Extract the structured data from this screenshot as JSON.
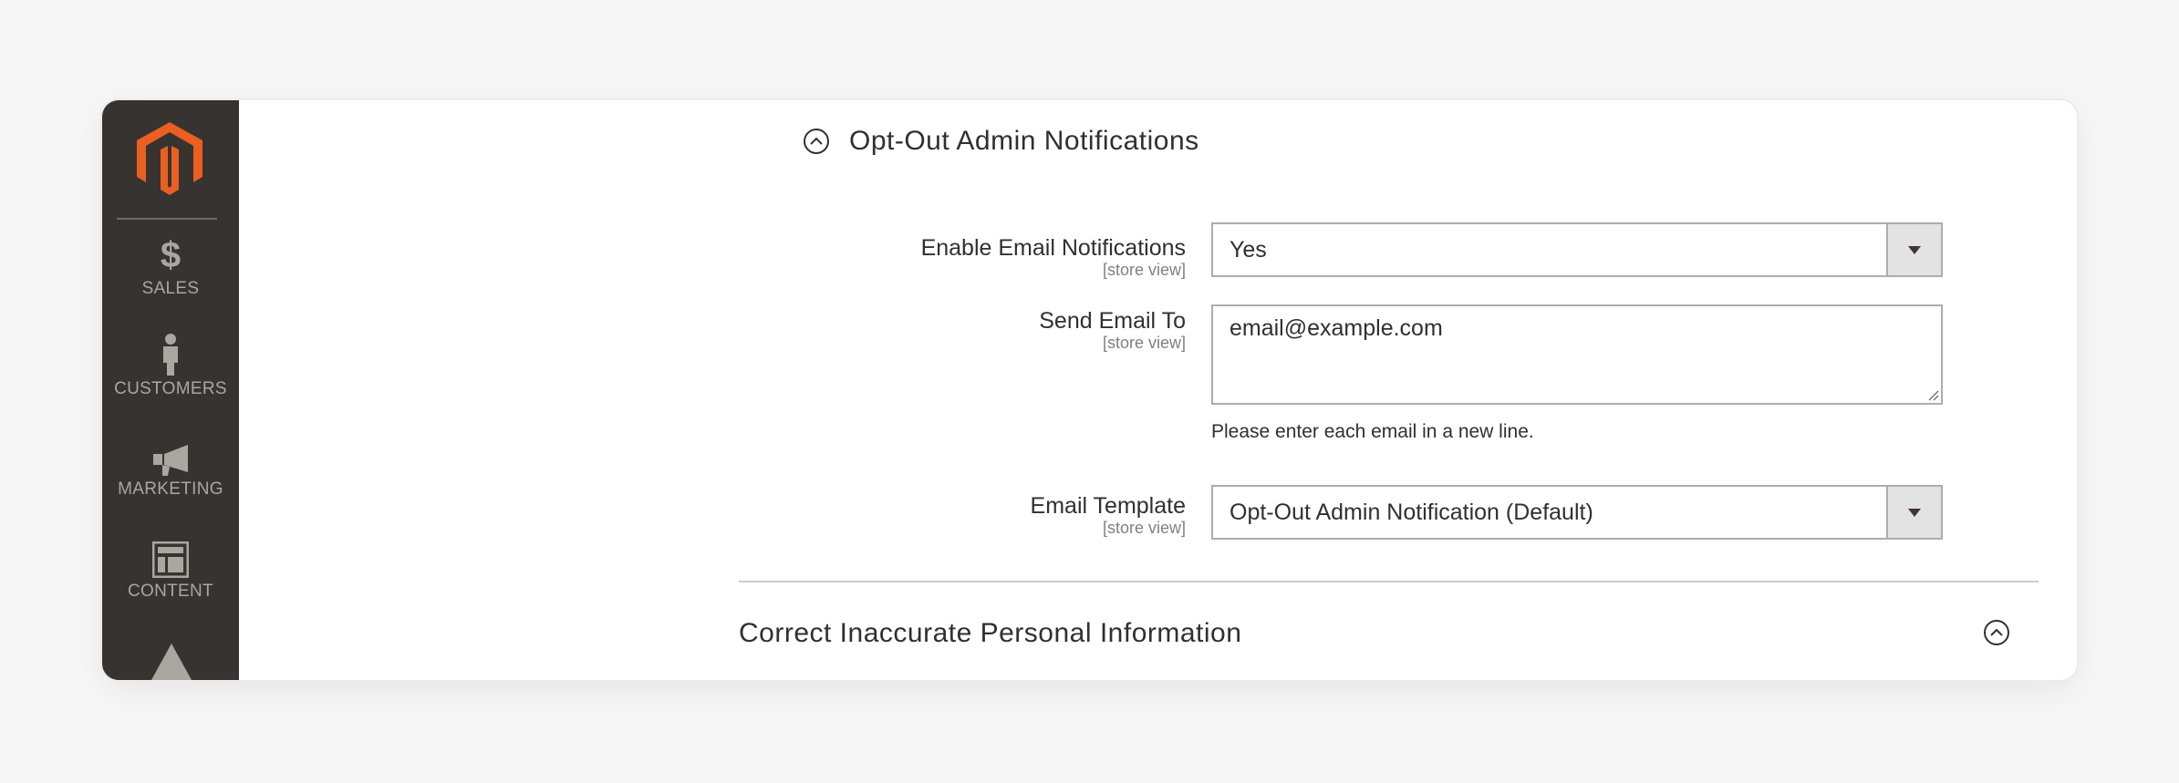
{
  "app": {
    "brand": "Magento",
    "brand_color": "#eb5202",
    "sidebar_bg": "#373330"
  },
  "sidebar": {
    "items": [
      {
        "label": "SALES",
        "icon": "dollar-icon"
      },
      {
        "label": "CUSTOMERS",
        "icon": "person-icon"
      },
      {
        "label": "MARKETING",
        "icon": "megaphone-icon"
      },
      {
        "label": "CONTENT",
        "icon": "layout-icon"
      },
      {
        "label": "",
        "icon": "stores-icon"
      }
    ]
  },
  "section": {
    "title": "Opt-Out Admin Notifications",
    "expanded": true,
    "fields": [
      {
        "label": "Enable Email Notifications",
        "scope": "[store view]",
        "type": "select",
        "value": "Yes"
      },
      {
        "label": "Send Email To",
        "scope": "[store view]",
        "type": "textarea",
        "value": "email@example.com",
        "note": "Please enter each email in a new line."
      },
      {
        "label": "Email Template",
        "scope": "[store view]",
        "type": "select",
        "value": "Opt-Out Admin Notification (Default)"
      }
    ]
  },
  "next_section": {
    "title": "Correct Inaccurate Personal Information"
  }
}
